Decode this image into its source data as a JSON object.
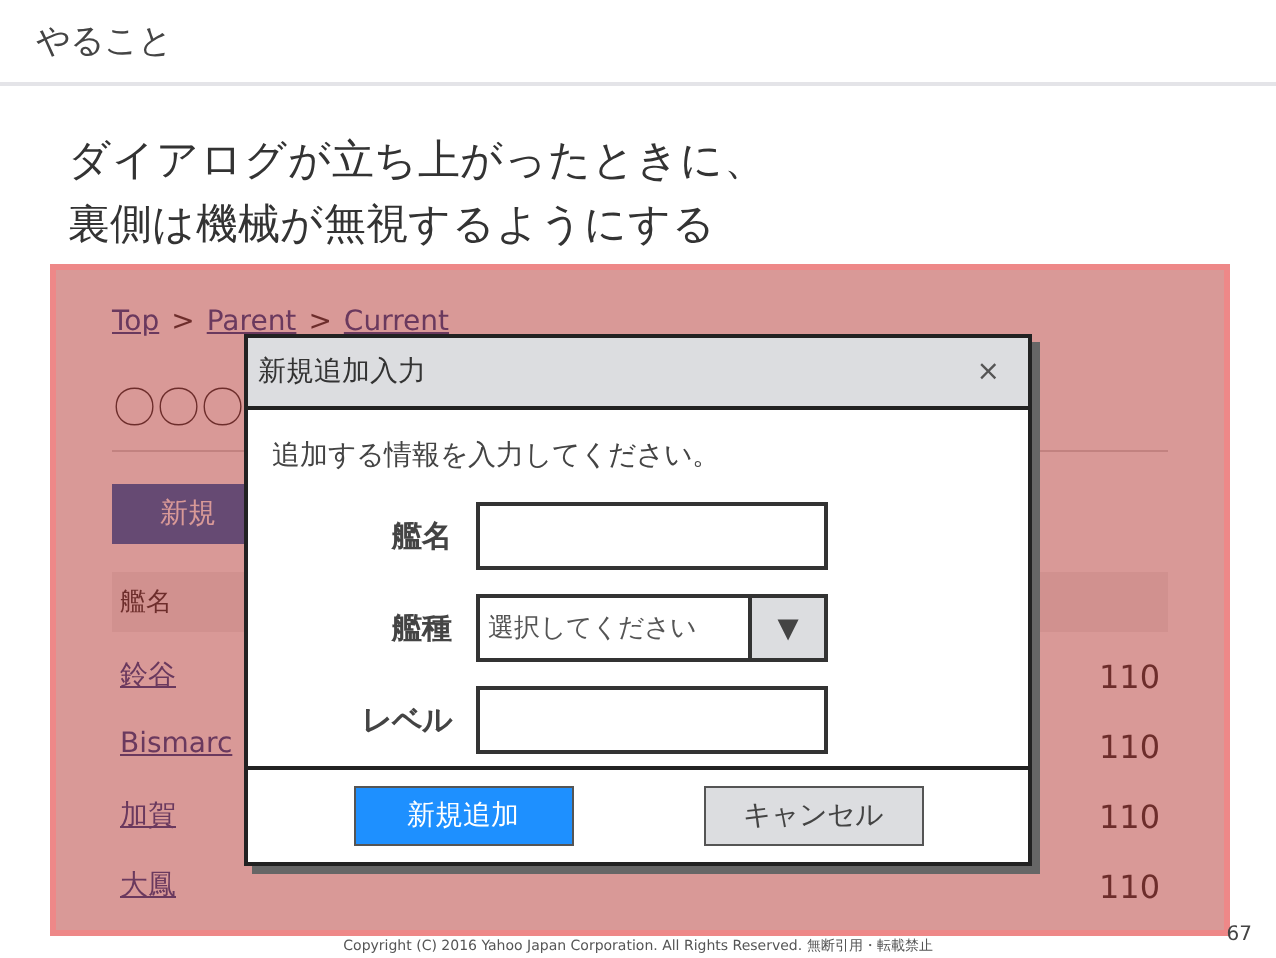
{
  "slide": {
    "title": "やること",
    "heading_lines": [
      "ダイアログが立ち上がったときに、",
      "裏側は機械が無視するようにする"
    ],
    "footer": "Copyright (C) 2016 Yahoo Japan Corporation. All Rights Reserved. 無断引用・転載禁止",
    "page_number": "67"
  },
  "background_page": {
    "breadcrumb": [
      "Top",
      "Parent",
      "Current"
    ],
    "breadcrumb_separator": ">",
    "heading": "〇〇〇",
    "add_button": "新規",
    "table": {
      "columns": [
        "艦名"
      ],
      "rows": [
        {
          "name": "鈴谷",
          "value": "110"
        },
        {
          "name": "Bismarc",
          "value": "110"
        },
        {
          "name": "加賀",
          "value": "110"
        },
        {
          "name": "大鳳",
          "value": "110"
        }
      ]
    }
  },
  "dialog": {
    "title": "新規追加入力",
    "close": "×",
    "message": "追加する情報を入力してください。",
    "fields": [
      {
        "kind": "text",
        "label": "艦名"
      },
      {
        "kind": "select",
        "label": "艦種",
        "placeholder": "選択してください",
        "caret": "▼"
      },
      {
        "kind": "text",
        "label": "レベル"
      }
    ],
    "buttons": [
      {
        "kind": "primary",
        "label": "新規追加"
      },
      {
        "kind": "secondary",
        "label": "キャンセル"
      }
    ]
  }
}
